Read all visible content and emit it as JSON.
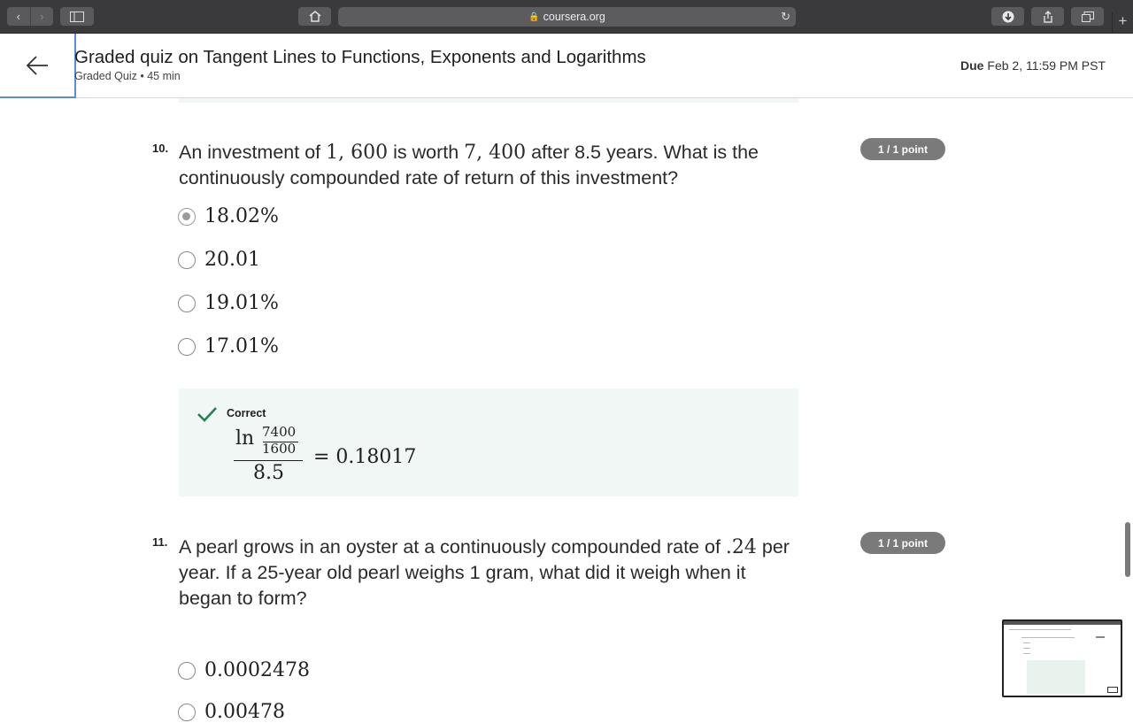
{
  "browser": {
    "url": "coursera.org",
    "back_glyph": "‹",
    "forward_glyph": "›",
    "plus_glyph": "+"
  },
  "header": {
    "title": "Graded quiz on Tangent Lines to Functions, Exponents and Logarithms",
    "subtitle": "Graded Quiz • 45 min",
    "due_label": "Due",
    "due_value": "Feb 2, 11:59 PM PST"
  },
  "questions": [
    {
      "number": "10.",
      "text_a": "An investment of ",
      "math_a": "1, 600",
      "text_b": " is worth ",
      "math_b": "7, 400",
      "text_c": " after 8.5 years. What is the continuously compounded rate of return of this investment?",
      "points": "1 / 1 point",
      "options": [
        {
          "label": "18.02%",
          "selected": true
        },
        {
          "label": "20.01",
          "selected": false
        },
        {
          "label": "19.01%",
          "selected": false
        },
        {
          "label": "17.01%",
          "selected": false
        }
      ],
      "feedback": {
        "label": "Correct",
        "ln": "ln",
        "frac_top": "7400",
        "frac_bottom": "1600",
        "denominator": "8.5",
        "result": "= 0.18017"
      }
    },
    {
      "number": "11.",
      "text_a": "A pearl grows in an oyster at a continuously compounded rate of ",
      "math_a": ".24",
      "text_b": " per year. If a 25-year old pearl weighs 1 gram, what did it weigh when it began to form?",
      "points": "1 / 1 point",
      "options": [
        {
          "label": "0.0002478",
          "selected": false
        },
        {
          "label": "0.00478",
          "selected": false
        }
      ]
    }
  ],
  "colors": {
    "accent_green": "#1f8354",
    "feedback_bg": "#f1f7f4",
    "pill_bg": "#7a7a7a",
    "focus_outline": "#5b8bd9"
  },
  "icons": {
    "back": "arrow-left-icon",
    "check": "checkmark-icon",
    "home": "home-icon",
    "lock": "lock-icon",
    "reload": "reload-icon",
    "download": "download-icon",
    "share": "share-icon",
    "tabs": "tabs-icon",
    "sidebar": "sidebar-icon"
  }
}
